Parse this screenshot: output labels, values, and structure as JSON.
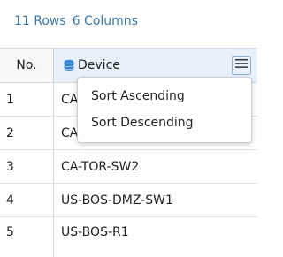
{
  "summary": {
    "rows": "11 Rows",
    "columns": "6 Columns"
  },
  "table": {
    "columns": [
      "No.",
      "Device"
    ],
    "rows": [
      {
        "no": "1",
        "device": "CA"
      },
      {
        "no": "2",
        "device": "CA"
      },
      {
        "no": "3",
        "device": "CA-TOR-SW2"
      },
      {
        "no": "4",
        "device": "US-BOS-DMZ-SW1"
      },
      {
        "no": "5",
        "device": "US-BOS-R1"
      }
    ]
  },
  "column_menu": {
    "items": [
      "Sort Ascending",
      "Sort Descending"
    ]
  },
  "colors": {
    "accent": "#3a78a8",
    "header_active": "#e8f1fb"
  },
  "icons": {
    "device_column": "database-icon",
    "column_menu": "hamburger-menu-icon"
  }
}
